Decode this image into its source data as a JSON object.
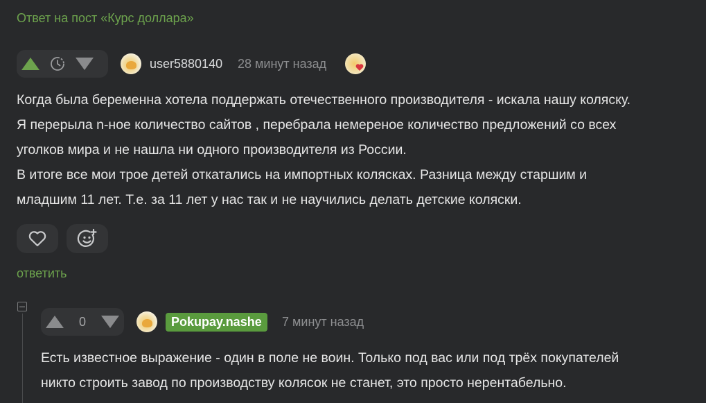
{
  "reply_header": "Ответ на пост «Курс доллара»",
  "main_comment": {
    "username": "user5880140",
    "time": "28 минут назад",
    "lines": [
      "Когда была беременна хотела поддержать отечественного производителя - искала нашу коляску.",
      "Я перерыла n-ное количество сайтов , перебрала немереное количество предложений со всех",
      "уголков мира и не нашла ни одного производителя из России.",
      "В итоге все мои трое детей откатались на импортных колясках. Разница между старшим и",
      "младшим 11 лет. Т.е. за 11 лет у нас так и не научились делать детские коляски."
    ],
    "reply_label": "ответить"
  },
  "child_comment": {
    "score": "0",
    "username": "Pokupay.nashe",
    "time": "7 минут назад",
    "lines": [
      "Есть известное выражение - один в поле не воин. Только под вас или под трёх покупателей",
      "никто строить завод по производству колясок не станет, это просто нерентабельно."
    ]
  },
  "colors": {
    "background": "#28292b",
    "accent_green": "#6da34d",
    "badge_green": "#5a9b3e"
  },
  "icons": {
    "upvote": "triangle-up",
    "downvote": "triangle-down",
    "rating_hidden": "clock-dashed",
    "like": "heart-outline",
    "reaction": "smiley-plus"
  }
}
